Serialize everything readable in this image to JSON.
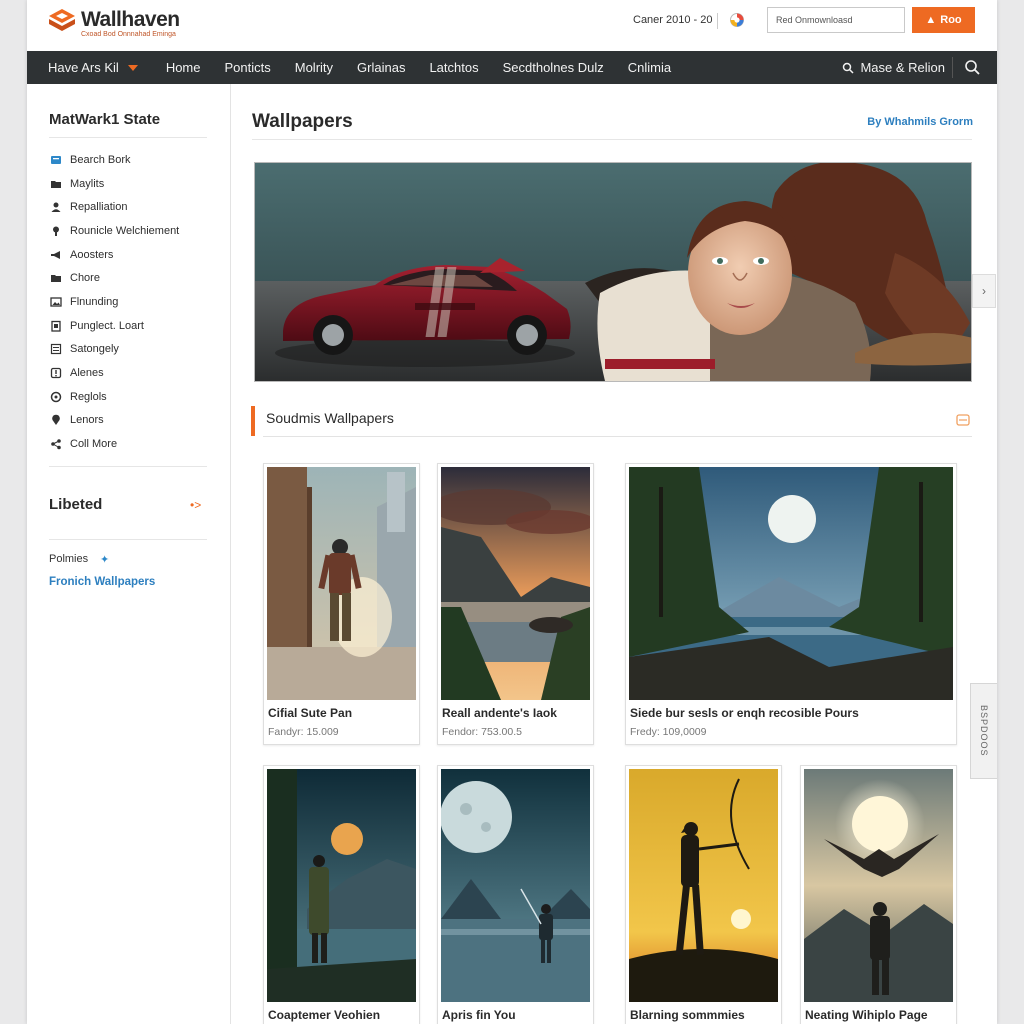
{
  "header": {
    "brand": "Wallhaven",
    "tagline": "Cxoad Bod Onnnahad Eminga",
    "counter": "Caner 2010 - 20",
    "download_placeholder": "Red Onmownloasd",
    "login_label": "Roo"
  },
  "nav": {
    "first": "Have Ars Kil",
    "items": [
      "Home",
      "Ponticts",
      "Molrity",
      "Grlainas",
      "Latchtos",
      "Secdtholnes Dulz",
      "Cnlimia"
    ],
    "right_label": "Mase & Relion"
  },
  "sidebar": {
    "title": "MatWark1 State",
    "items": [
      {
        "label": "Bearch Bork",
        "icon": "bookmark-icon"
      },
      {
        "label": "Maylits",
        "icon": "folder-icon"
      },
      {
        "label": "Repalliation",
        "icon": "user-icon"
      },
      {
        "label": "Rounicle Welchiement",
        "icon": "award-icon"
      },
      {
        "label": "Aoosters",
        "icon": "megaphone-icon"
      },
      {
        "label": "Chore",
        "icon": "folder-icon"
      },
      {
        "label": "Flnunding",
        "icon": "image-icon"
      },
      {
        "label": "Punglect. Loart",
        "icon": "clipboard-icon"
      },
      {
        "label": "Satongely",
        "icon": "list-icon"
      },
      {
        "label": "Alenes",
        "icon": "alert-icon"
      },
      {
        "label": "Reglols",
        "icon": "target-icon"
      },
      {
        "label": "Lenors",
        "icon": "pin-icon"
      },
      {
        "label": "Coll More",
        "icon": "share-icon"
      }
    ],
    "section_title": "Libeted",
    "section_arrow": "•>",
    "polmies": "Polmies",
    "link": "Fronich Wallpapers"
  },
  "main": {
    "title": "Wallpapers",
    "by_link": "By Whahmils Grorm",
    "section_title": "Soudmis Wallpapers",
    "side_tab": "BSPDOOS",
    "cards": [
      {
        "title": "Cifial Sute Pan",
        "meta": "Fandyr: 15.009"
      },
      {
        "title": "Reall andente's Iaok",
        "meta": "Fendor: 753.00.5"
      },
      {
        "title": "Siede bur sesls or enqh recosible Pours",
        "meta": "Fredy: 109,0009"
      },
      {
        "title": "Coaptemer Veohien",
        "meta": ""
      },
      {
        "title": "Apris fin You",
        "meta": ""
      },
      {
        "title": "Blarning sommmies",
        "meta": ""
      },
      {
        "title": "Neating Wihiplo Page",
        "meta": ""
      }
    ]
  },
  "colors": {
    "accent": "#ee6a22",
    "nav_bg": "#2e3234",
    "link": "#2d7fbf"
  }
}
